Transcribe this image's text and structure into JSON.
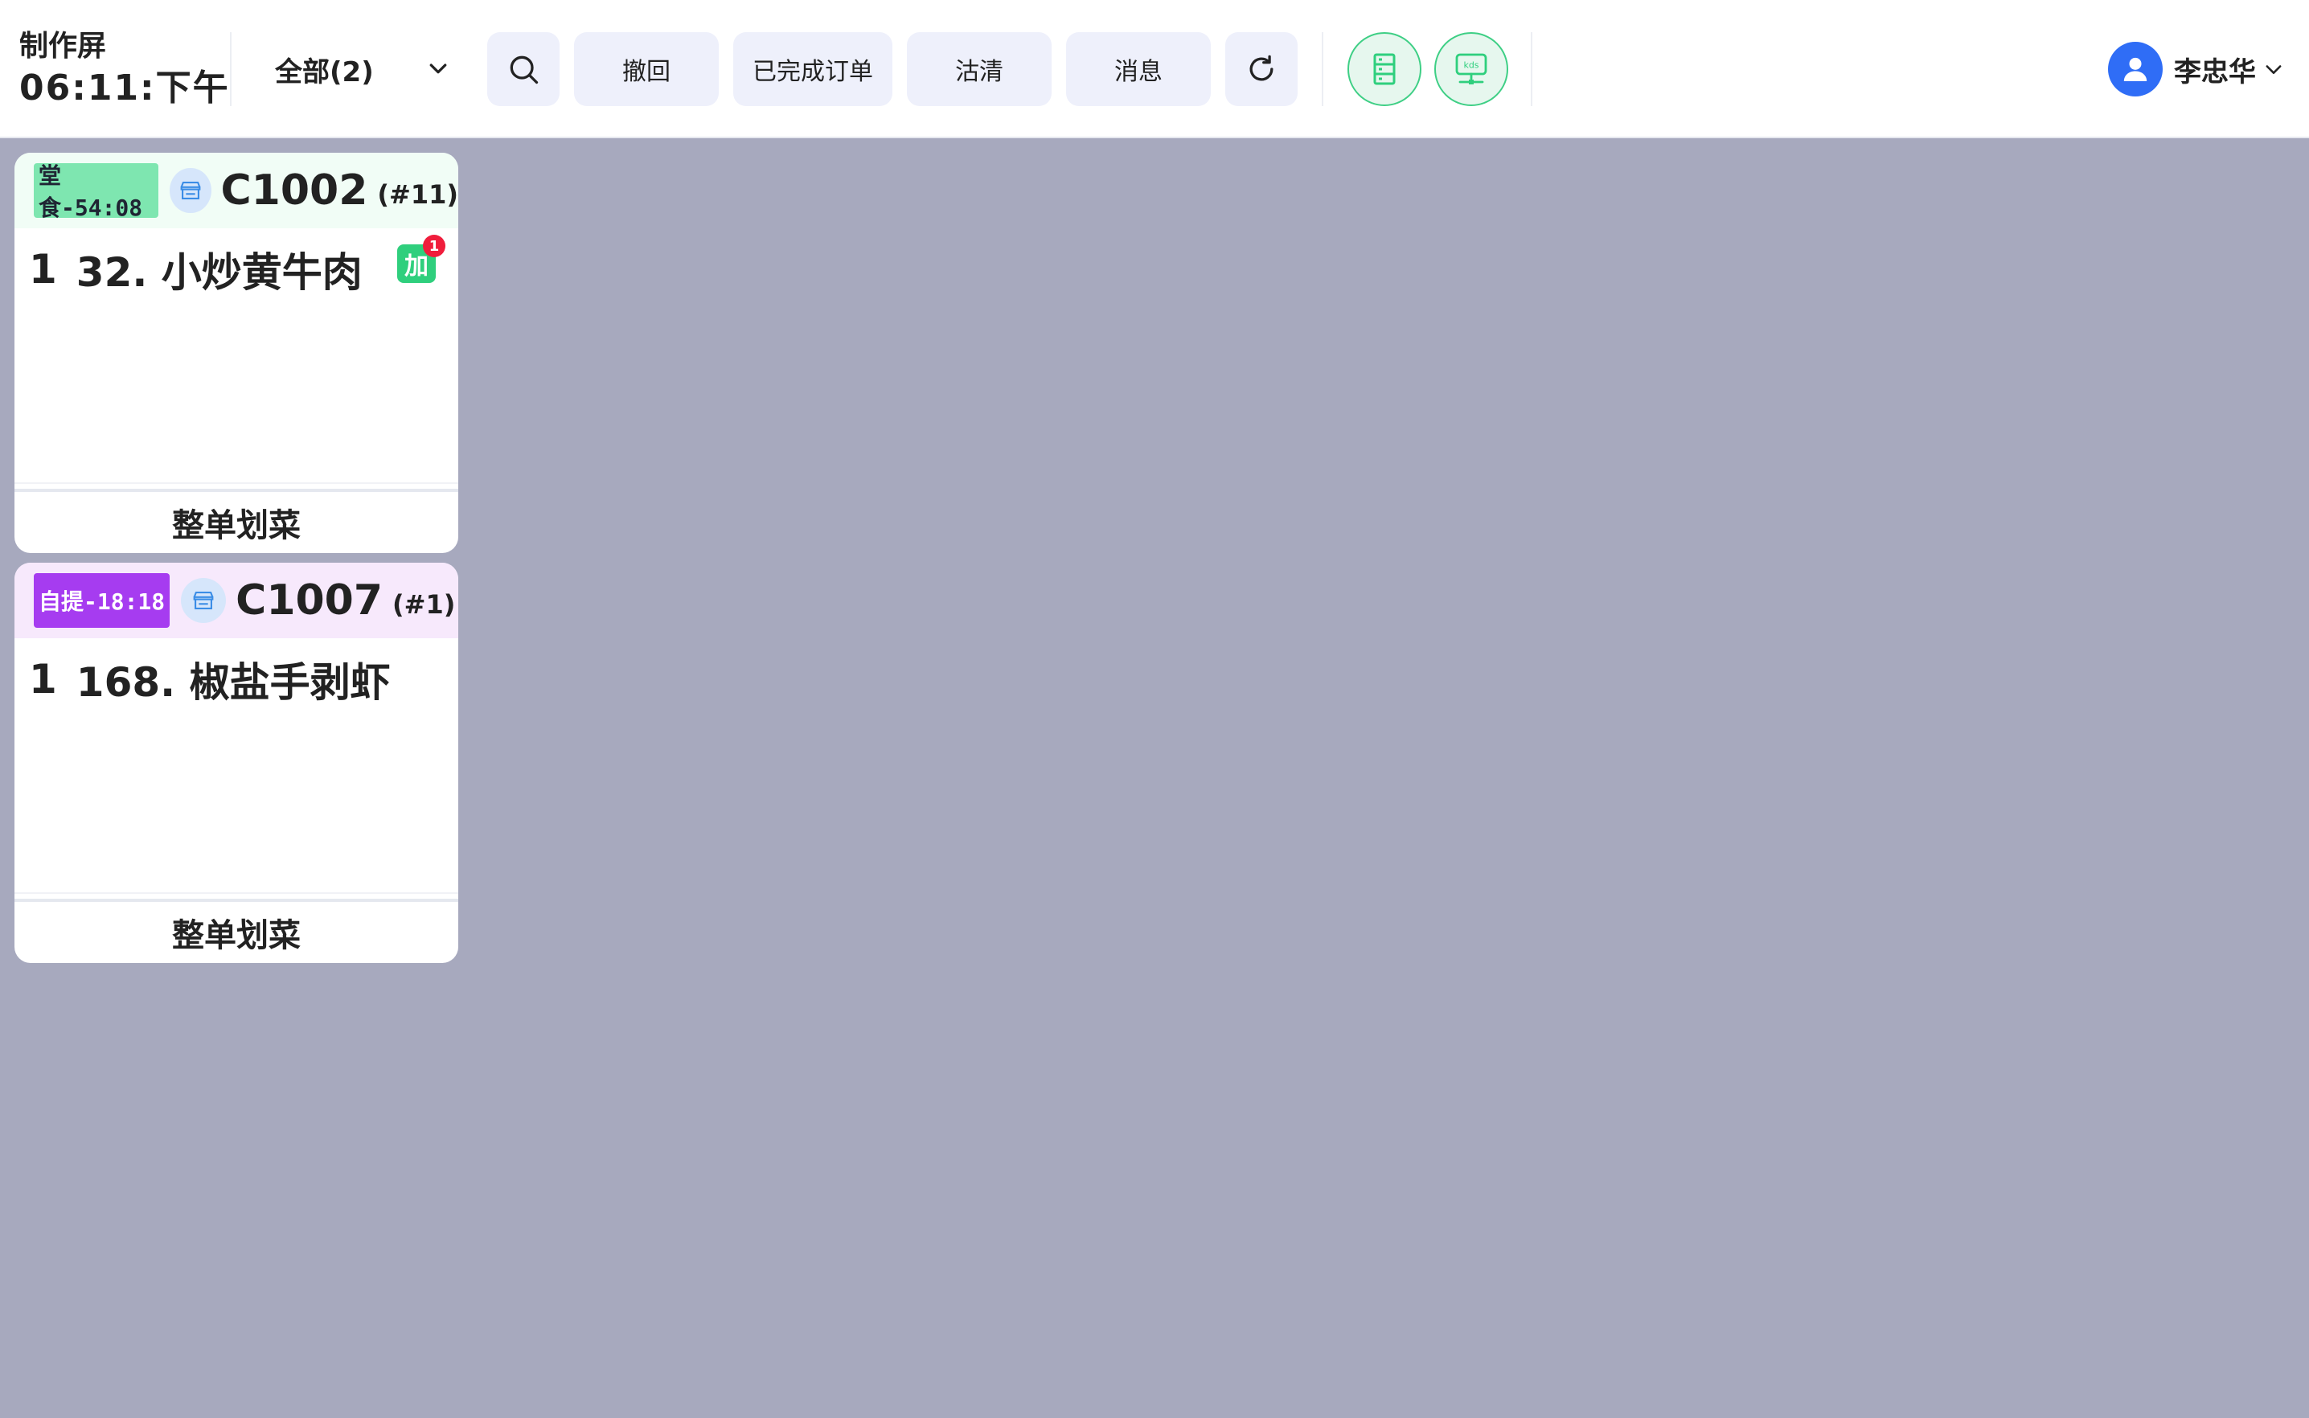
{
  "header": {
    "title": "制作屏",
    "clock": "06:11:下午",
    "filter_label": "全部(2)",
    "buttons": {
      "recall": "撤回",
      "completed": "已完成订单",
      "soldout": "沽清",
      "messages": "消息"
    },
    "user_name": "李忠华"
  },
  "colors": {
    "accent_green": "#2fcf7d",
    "dine_in_tag": "#7ee6b0",
    "pickup_tag": "#a63cf0",
    "badge_red": "#f01d3c",
    "avatar_blue": "#2f6df6"
  },
  "orders": [
    {
      "tag": "堂食-54:08",
      "order_no": "C1002",
      "seq": "(#11)",
      "item_qty": "1",
      "item_name": "32. 小炒黄牛肉",
      "add_label": "加",
      "add_count": "1",
      "action": "整单划菜"
    },
    {
      "tag": "自提-18:18",
      "order_no": "C1007",
      "seq": "(#1)",
      "item_qty": "1",
      "item_name": "168. 椒盐手剥虾",
      "action": "整单划菜"
    }
  ]
}
